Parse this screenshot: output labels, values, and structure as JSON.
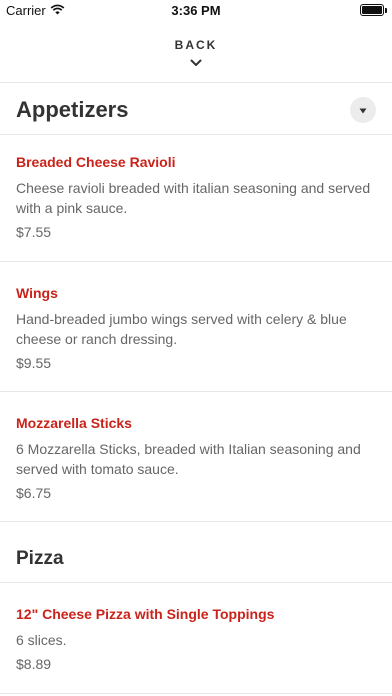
{
  "status_bar": {
    "carrier": "Carrier",
    "time": "3:36 PM",
    "wifi_icon": "wifi-icon",
    "battery_level": 1.0
  },
  "nav": {
    "back_label": "BACK",
    "chevron_icon": "chevron-down-icon"
  },
  "sections": [
    {
      "title": "Appetizers",
      "expand_icon": "caret-down-icon",
      "items": [
        {
          "name": "Breaded Cheese Ravioli",
          "description": "Cheese ravioli breaded with italian seasoning and served with a pink sauce.",
          "price": "$7.55"
        },
        {
          "name": "Wings",
          "description": "Hand-breaded jumbo wings served with celery & blue cheese or ranch dressing.",
          "price": "$9.55"
        },
        {
          "name": "Mozzarella Sticks",
          "description": "6 Mozzarella Sticks, breaded with Italian seasoning and served with tomato sauce.",
          "price": "$6.75"
        }
      ]
    },
    {
      "title": "Pizza",
      "items": [
        {
          "name": "12\" Cheese Pizza with Single Toppings",
          "description": "6 slices.",
          "price": "$8.89"
        }
      ]
    }
  ],
  "colors": {
    "item_name": "#c9231a",
    "text_secondary": "#666666",
    "divider": "#e6e6e6"
  }
}
